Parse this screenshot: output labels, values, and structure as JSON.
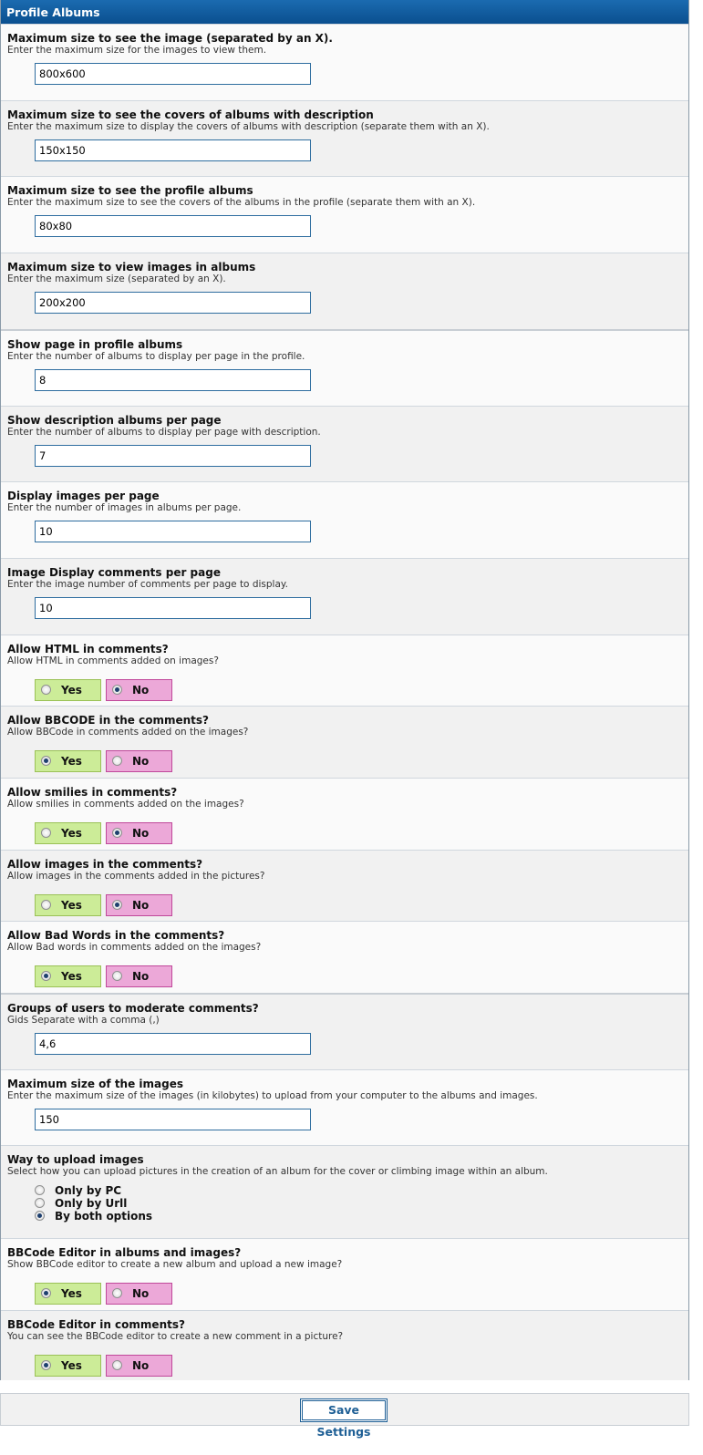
{
  "panel": {
    "title": "Profile Albums"
  },
  "settings": [
    {
      "type": "text",
      "label": "Maximum size to see the image (separated by an X).",
      "desc": "Enter the maximum size for the images to view them.",
      "value": "800x600"
    },
    {
      "type": "text",
      "label": "Maximum size to see the covers of albums with description",
      "desc": "Enter the maximum size to display the covers of albums with description (separate them with an X).",
      "value": "150x150"
    },
    {
      "type": "text",
      "label": "Maximum size to see the profile albums",
      "desc": "Enter the maximum size to see the covers of the albums in the profile (separate them with an X).",
      "value": "80x80"
    },
    {
      "type": "text",
      "label": "Maximum size to view images in albums",
      "desc": "Enter the maximum size (separated by an X).",
      "value": "200x200"
    },
    {
      "type": "text",
      "label": "Show page in profile albums",
      "desc": "Enter the number of albums to display per page in the profile.",
      "value": "8"
    },
    {
      "type": "text",
      "label": "Show description albums per page",
      "desc": "Enter the number of albums to display per page with description.",
      "value": "7"
    },
    {
      "type": "text",
      "label": "Display images per page",
      "desc": "Enter the number of images in albums per page.",
      "value": "10"
    },
    {
      "type": "text",
      "label": "Image Display comments per page",
      "desc": "Enter the image number of comments per page to display.",
      "value": "10"
    },
    {
      "type": "yesno",
      "label": "Allow HTML in comments?",
      "desc": "Allow HTML in comments added on images?",
      "selected": "No"
    },
    {
      "type": "yesno",
      "label": "Allow BBCODE in the comments?",
      "desc": "Allow BBCode in comments added on the images?",
      "selected": "Yes"
    },
    {
      "type": "yesno",
      "label": "Allow smilies in comments?",
      "desc": "Allow smilies in comments added on the images?",
      "selected": "No"
    },
    {
      "type": "yesno",
      "label": "Allow images in the comments?",
      "desc": "Allow images in the comments added in the pictures?",
      "selected": "No"
    },
    {
      "type": "yesno",
      "label": "Allow Bad Words in the comments?",
      "desc": "Allow Bad words in comments added on the images?",
      "selected": "Yes"
    },
    {
      "type": "text",
      "label": "Groups of users to moderate comments?",
      "desc": "Gids Separate with a comma (,)",
      "value": "4,6"
    },
    {
      "type": "text",
      "label": "Maximum size of the images",
      "desc": "Enter the maximum size of the images (in kilobytes) to upload from your computer to the albums and images.",
      "value": "150"
    },
    {
      "type": "radio",
      "label": "Way to upload images",
      "desc": "Select how you can upload pictures in the creation of an album for the cover or climbing image within an album.",
      "options": [
        "Only by PC",
        "Only by Urll",
        "By both options"
      ],
      "selected": "By both options"
    },
    {
      "type": "yesno",
      "label": "BBCode Editor in albums and images?",
      "desc": "Show BBCode editor to create a new album and upload a new image?",
      "selected": "Yes"
    },
    {
      "type": "yesno",
      "label": "BBCode Editor in comments?",
      "desc": "You can see the BBCode editor to create a new comment in a picture?",
      "selected": "Yes"
    }
  ],
  "yes_label": "Yes",
  "no_label": "No",
  "footer": {
    "save_label": "Save Settings"
  }
}
